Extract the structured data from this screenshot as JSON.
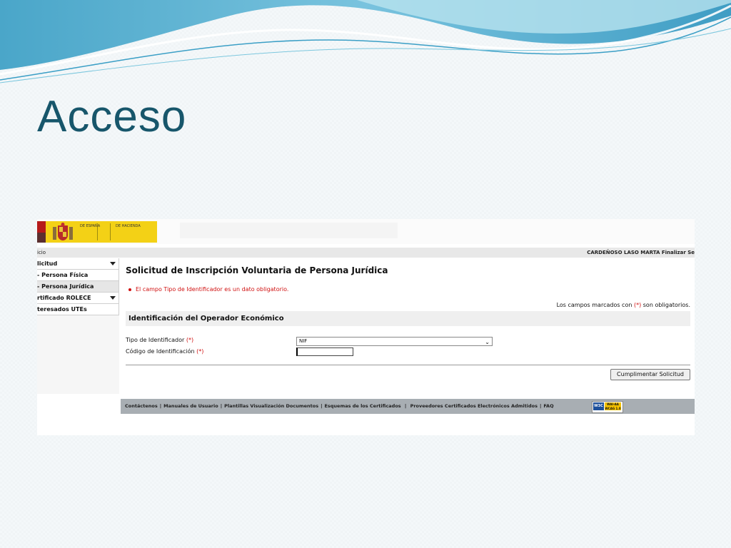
{
  "slide": {
    "title": "Acceso"
  },
  "header": {
    "logo_text_1": "DE ESPAÑA",
    "logo_text_2": "DE HACIENDA"
  },
  "topbar": {
    "breadcrumb": "icio",
    "user": "CARDEÑOSO LASO MARTA Finalizar Se"
  },
  "sidebar": {
    "items": [
      {
        "label": "licitud"
      },
      {
        "label": "- Persona Física"
      },
      {
        "label": "- Persona Jurídica"
      },
      {
        "label": "rtificado ROLECE"
      },
      {
        "label": "teresados UTEs"
      }
    ]
  },
  "main": {
    "title": "Solicitud de Inscripción Voluntaria de Persona Jurídica",
    "error": "El campo Tipo de Identificador es un dato obligatorio.",
    "required_note_prefix": "Los campos marcados con",
    "required_mark": "(*)",
    "required_note_suffix": "son obligatorios.",
    "section_title": "Identificación del Operador Económico",
    "field_tipo_label": "Tipo de Identificador",
    "field_tipo_value": "NIF",
    "field_codigo_label": "Código de Identificación",
    "field_codigo_value": "",
    "submit_label": "Cumplimentar Solicitud"
  },
  "footer": {
    "links": [
      "Contáctenos",
      "Manuales de Usuario",
      "Plantillas Visualización Documentos",
      "Esquemas de los Certificados",
      "Proveedores Certificados Electrónicos Admitidos",
      "FAQ"
    ],
    "badge_w3c": "W3C",
    "badge_wai": "WAI-AA",
    "badge_wcag": "WCAG 1.0"
  },
  "colors": {
    "title": "#17566b",
    "error": "#d01010",
    "logo_yellow": "#f3d116",
    "footer": "#a8aeb3"
  }
}
